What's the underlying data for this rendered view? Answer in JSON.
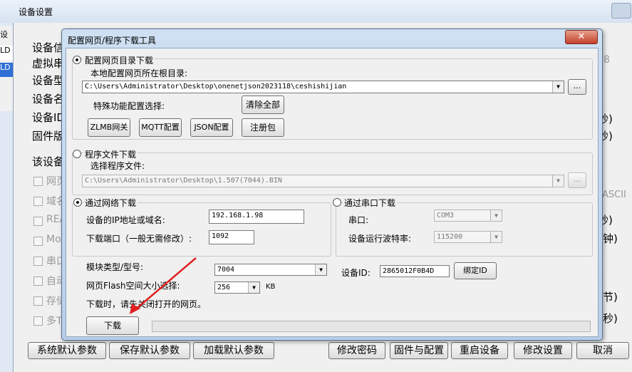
{
  "outer": {
    "title": "设备设置",
    "left_tabs": [
      "设",
      "LD",
      "LD"
    ],
    "bg_labels": [
      "设备信",
      "虚拟串",
      "设备型",
      "设备名",
      "设备ID",
      "固件版",
      "该设备"
    ],
    "bg_check_labels": [
      "网页",
      "域名",
      "REA",
      "Moc",
      "串口",
      "自动",
      "存储",
      "多T"
    ],
    "bg_right_texts": [
      "8",
      "秒)",
      "秒)",
      "ASCII",
      "秒)",
      "分钟)",
      "字节)",
      "毫秒)"
    ],
    "buttons": [
      "系统默认参数",
      "保存默认参数",
      "加载默认参数",
      "修改密码",
      "固件与配置",
      "重启设备",
      "修改设置",
      "取消"
    ]
  },
  "dialog": {
    "title": "配置网页/程序下载工具",
    "close_label": "✕",
    "web_dir": {
      "radio_label": "配置网页目录下载",
      "path_label": "本地配置网页所在根目录:",
      "path_value": "C:\\Users\\Administrator\\Desktop\\onenetjson2023118\\ceshishijian",
      "browse_label": "...",
      "special_label": "特殊功能配置选择:",
      "clear_all": "清除全部",
      "option_buttons": [
        "ZLMB网关",
        "MQTT配置",
        "JSON配置",
        "注册包"
      ]
    },
    "program": {
      "radio_label": "程序文件下载",
      "file_label": "选择程序文件:",
      "file_value": "C:\\Users\\Administrator\\Desktop\\1.507(7044).BIN",
      "browse_label": "..."
    },
    "network": {
      "radio_label": "通过网络下载",
      "ip_label": "设备的IP地址或域名:",
      "ip_value": "192.168.1.98",
      "port_label": "下载端口（一般无需修改）:",
      "port_value": "1092"
    },
    "serial": {
      "radio_label": "通过串口下载",
      "port_label": "串口:",
      "port_value": "COM3",
      "baud_label": "设备运行波特率:",
      "baud_value": "115200"
    },
    "module_label": "模块类型/型号:",
    "module_value": "7004",
    "flash_label": "网页Flash空间大小选择:",
    "flash_value": "256",
    "flash_unit": "KB",
    "device_id_label": "设备ID:",
    "device_id_value": "2865012F0B4D",
    "bind_id": "绑定ID",
    "hint": "下载时，请先关闭打开的网页。",
    "download": "下载",
    "progress": 0
  },
  "colors": {
    "annotation_arrow": "#e02020"
  }
}
